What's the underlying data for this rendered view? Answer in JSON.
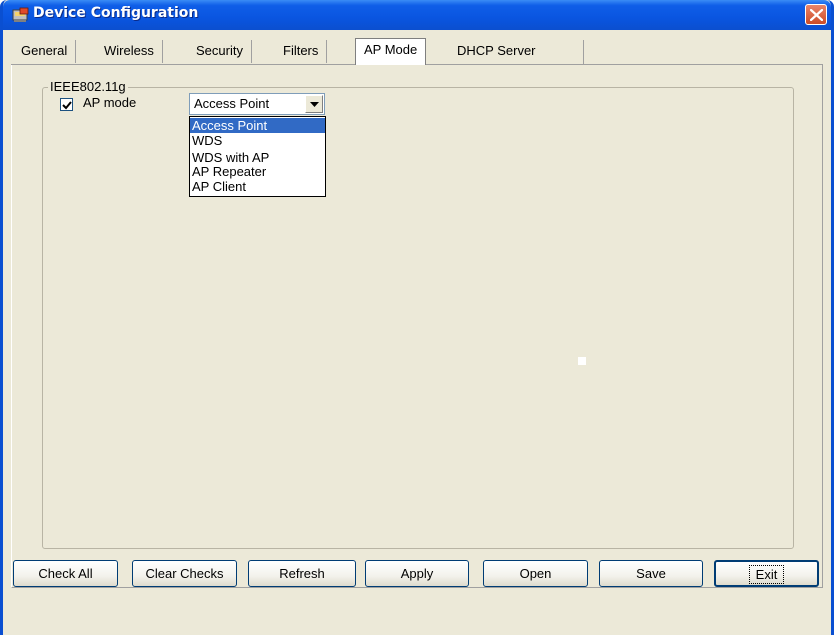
{
  "window": {
    "title": "Device Configuration",
    "icon": "device-icon",
    "close_icon": "close-icon"
  },
  "tabs": [
    {
      "label": "General"
    },
    {
      "label": "Wireless"
    },
    {
      "label": "Security"
    },
    {
      "label": "Filters"
    },
    {
      "label": "AP Mode",
      "active": true
    },
    {
      "label": "DHCP Server"
    }
  ],
  "group": {
    "label": "IEEE802.11g"
  },
  "ap_mode": {
    "checkbox_label": "AP mode",
    "checked": true,
    "selected": "Access Point",
    "options": [
      "Access Point",
      "WDS",
      "WDS with AP",
      "AP Repeater",
      "AP Client"
    ]
  },
  "buttons": {
    "check_all": "Check All",
    "clear_checks": "Clear Checks",
    "refresh": "Refresh",
    "apply": "Apply",
    "open": "Open",
    "save": "Save",
    "exit": "Exit"
  },
  "colors": {
    "titlebar": "#0a55e0",
    "selection": "#316ac5",
    "close": "#cd4b26"
  }
}
